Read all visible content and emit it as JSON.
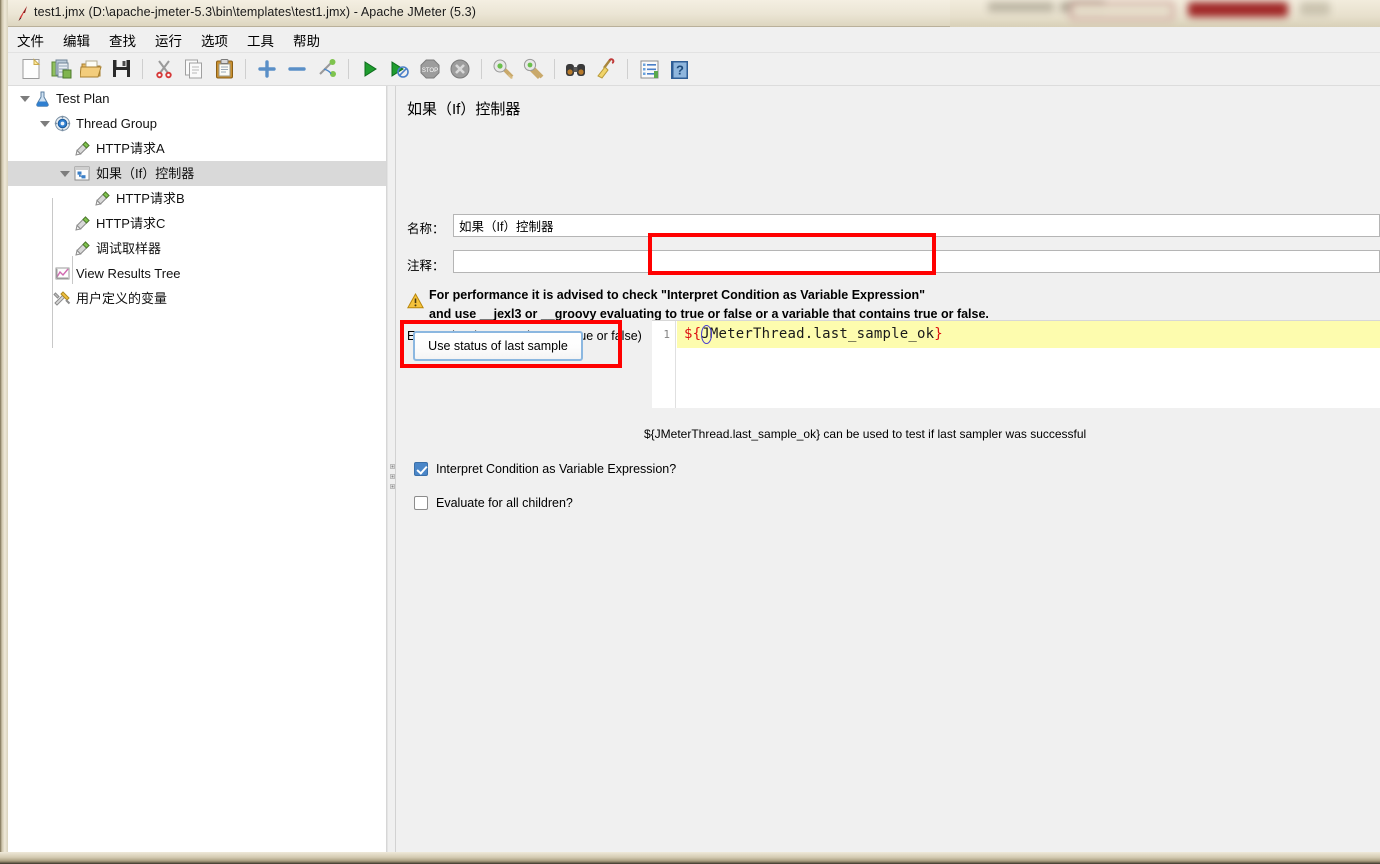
{
  "window": {
    "title": "test1.jmx (D:\\apache-jmeter-5.3\\bin\\templates\\test1.jmx) - Apache JMeter (5.3)",
    "app_icon": "jmeter-feather-icon"
  },
  "menubar": {
    "items": [
      {
        "label": "文件",
        "name": "menu-file"
      },
      {
        "label": "编辑",
        "name": "menu-edit"
      },
      {
        "label": "查找",
        "name": "menu-search"
      },
      {
        "label": "运行",
        "name": "menu-run"
      },
      {
        "label": "选项",
        "name": "menu-options"
      },
      {
        "label": "工具",
        "name": "menu-tools"
      },
      {
        "label": "帮助",
        "name": "menu-help"
      }
    ]
  },
  "toolbar": {
    "buttons": [
      {
        "icon": "new-document-icon",
        "name": "toolbar-new"
      },
      {
        "icon": "templates-icon",
        "name": "toolbar-templates"
      },
      {
        "icon": "open-folder-icon",
        "name": "toolbar-open"
      },
      {
        "icon": "save-floppy-icon",
        "name": "toolbar-save"
      },
      {
        "icon": "cut-scissors-icon",
        "name": "toolbar-cut"
      },
      {
        "icon": "copy-pages-icon",
        "name": "toolbar-copy"
      },
      {
        "icon": "paste-clipboard-icon",
        "name": "toolbar-paste"
      },
      {
        "icon": "plus-icon",
        "name": "toolbar-expand-all"
      },
      {
        "icon": "minus-icon",
        "name": "toolbar-collapse-all"
      },
      {
        "icon": "toggle-icon",
        "name": "toolbar-toggle"
      },
      {
        "icon": "play-green-icon",
        "name": "toolbar-start"
      },
      {
        "icon": "play-no-timers-icon",
        "name": "toolbar-start-no-pauses"
      },
      {
        "icon": "stop-icon",
        "name": "toolbar-stop"
      },
      {
        "icon": "shutdown-icon",
        "name": "toolbar-shutdown"
      },
      {
        "icon": "clear-icon",
        "name": "toolbar-clear"
      },
      {
        "icon": "clear-all-icon",
        "name": "toolbar-clear-all"
      },
      {
        "icon": "binoculars-icon",
        "name": "toolbar-search"
      },
      {
        "icon": "broom-icon",
        "name": "toolbar-reset-search"
      },
      {
        "icon": "function-helper-icon",
        "name": "toolbar-function-helper"
      },
      {
        "icon": "help-book-icon",
        "name": "toolbar-help"
      }
    ]
  },
  "tree": {
    "nodes": [
      {
        "label": "Test Plan",
        "icon": "test-plan-icon",
        "depth": 0,
        "toggle": "expanded",
        "selected": false
      },
      {
        "label": "Thread Group",
        "icon": "thread-group-icon",
        "depth": 1,
        "toggle": "expanded",
        "selected": false
      },
      {
        "label": "HTTP请求A",
        "icon": "http-sampler-icon",
        "depth": 2,
        "toggle": "none",
        "selected": false
      },
      {
        "label": "如果（If）控制器",
        "icon": "if-controller-icon",
        "depth": 2,
        "toggle": "expanded",
        "selected": true
      },
      {
        "label": "HTTP请求B",
        "icon": "http-sampler-icon",
        "depth": 3,
        "toggle": "none",
        "selected": false
      },
      {
        "label": "HTTP请求C",
        "icon": "http-sampler-icon",
        "depth": 2,
        "toggle": "none",
        "selected": false
      },
      {
        "label": "调试取样器",
        "icon": "http-sampler-icon",
        "depth": 2,
        "toggle": "none",
        "selected": false
      },
      {
        "label": "View Results Tree",
        "icon": "results-tree-icon",
        "depth": 1,
        "toggle": "none",
        "selected": false
      },
      {
        "label": "用户定义的变量",
        "icon": "user-variables-icon",
        "depth": 1,
        "toggle": "none",
        "selected": false
      }
    ]
  },
  "panel": {
    "title": "如果（If）控制器",
    "name_label": "名称：",
    "name_value": "如果（If）控制器",
    "comment_label": "注释：",
    "comment_value": "",
    "warning_line1": "For performance it is advised to check \"Interpret Condition as Variable Expression\"",
    "warning_line2": "and use __jexl3 or __groovy evaluating to true or false or a variable that contains true or false.",
    "warning_icon": "warning-triangle-icon",
    "expression_label": "Expression (must evaluate to true or false)",
    "expression_line_number": "1",
    "expression_prefix": "${",
    "expression_body": "JMeterThread.last_sample_ok",
    "expression_suffix": "}",
    "last_sample_button": "Use status of last sample",
    "hint": "${JMeterThread.last_sample_ok} can be used to test if last sampler was successful",
    "checkbox_interpret": "Interpret Condition as Variable Expression?",
    "checkbox_interpret_checked": true,
    "checkbox_evaluate_all": "Evaluate for all children?",
    "checkbox_evaluate_all_checked": false
  },
  "colors": {
    "annotation_red": "#ff0000",
    "current_line_yellow": "#fdfcae",
    "selection_gray": "#d9d9d9",
    "focus_blue": "#8bb7e0",
    "checkbox_blue": "#4a86c8",
    "code_red": "#dd1111"
  }
}
